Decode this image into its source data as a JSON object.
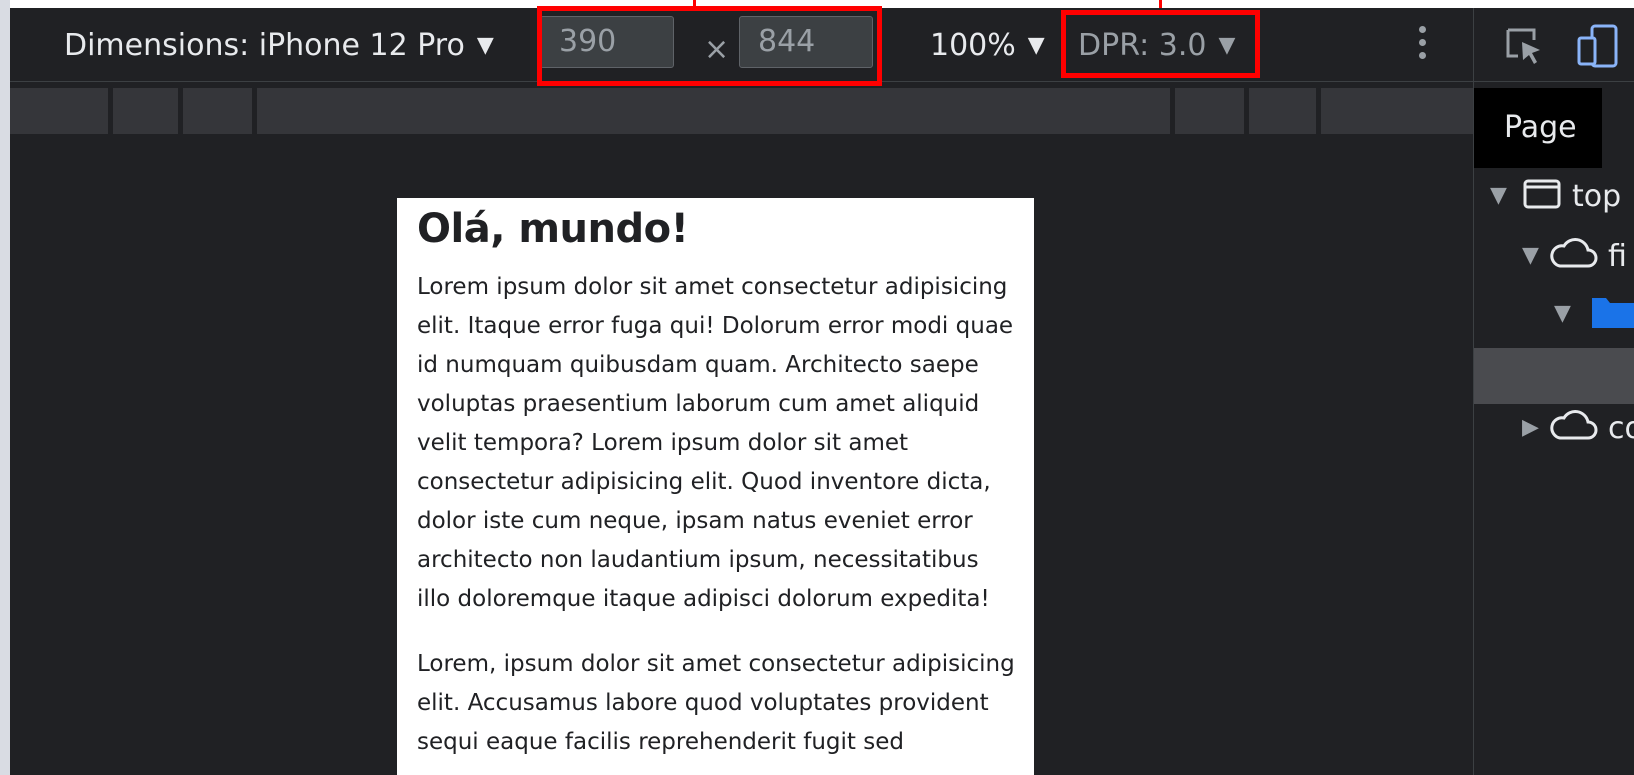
{
  "toolbar": {
    "device_label": "Dimensions: iPhone 12 Pro",
    "width_value": "390",
    "times_sign": "×",
    "height_value": "844",
    "zoom_label": "100%",
    "dpr_label": "DPR: 3.0",
    "caret": "▼"
  },
  "page": {
    "heading": "Olá, mundo!",
    "paragraph1": "Lorem ipsum dolor sit amet consectetur adipisicing elit. Itaque error fuga qui! Dolorum error modi quae id numquam quibusdam quam. Architecto saepe voluptas praesentium laborum cum amet aliquid velit tempora? Lorem ipsum dolor sit amet consectetur adipisicing elit. Quod inventore dicta, dolor iste cum neque, ipsam natus eveniet error architecto non laudantium ipsum, necessitatibus illo doloremque itaque adipisci dolorum expedita!",
    "paragraph2": "Lorem, ipsum dolor sit amet consectetur adipisicing elit. Accusamus labore quod voluptates provident sequi eaque facilis reprehenderit fugit sed"
  },
  "panel": {
    "tab_label": "Page",
    "tree": {
      "top_label": "top",
      "frame1_label": "fi",
      "frame2_label": "co",
      "expanded_glyph": "▼",
      "collapsed_glyph": "▶"
    }
  },
  "colors": {
    "highlight": "#ff0000",
    "toolbar_bg": "#202124",
    "page_bg": "#ffffff",
    "folder_blue": "#1a73e8"
  },
  "icons": [
    "more-vert-icon",
    "inspect-element-icon",
    "device-toolbar-icon",
    "frame-window-icon",
    "cloud-icon",
    "folder-icon"
  ]
}
